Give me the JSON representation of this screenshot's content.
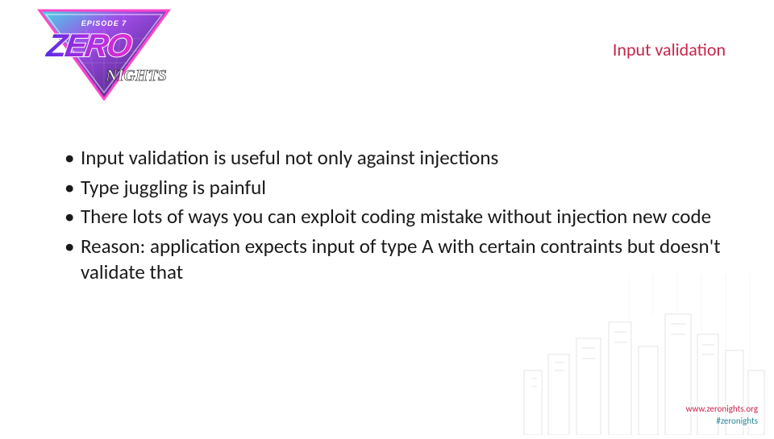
{
  "logo": {
    "episode": "EPISODE 7",
    "main": "ZERO",
    "sub": "NIGHTS"
  },
  "title": "Input validation",
  "bullets": [
    "Input validation is useful not only against injections",
    "Type juggling is painful",
    "There lots of ways you can exploit coding mistake without injection new code",
    "Reason: application expects input of type A with certain contraints but doesn't validate that"
  ],
  "footer": {
    "url": "www.zeronights.org",
    "hashtag": "#zeronights"
  }
}
